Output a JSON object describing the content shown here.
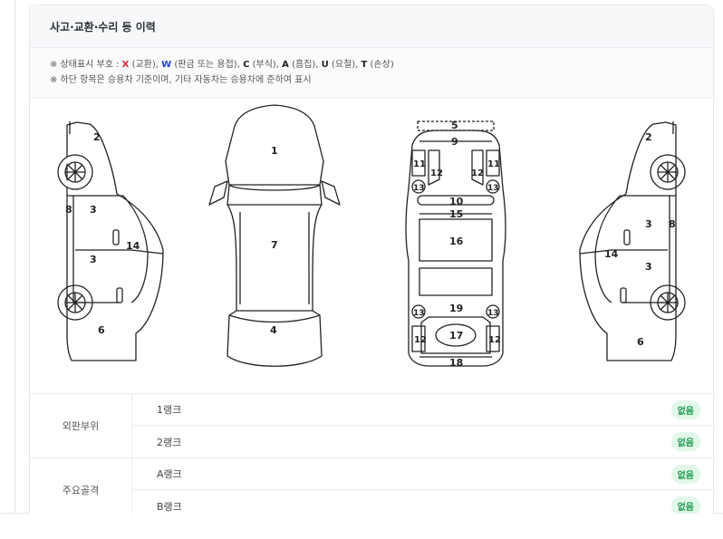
{
  "section": {
    "title": "사고·교환·수리 등 이력"
  },
  "legend": {
    "line1_prefix": "※ 상태표시 부호 : ",
    "x_code": "X",
    "x_text": " (교환), ",
    "w_code": "W",
    "w_text": " (판금 또는 용접), ",
    "c_code": "C",
    "c_text": " (부식), ",
    "a_code": "A",
    "a_text": " (흠집), ",
    "u_code": "U",
    "u_text": " (요철), ",
    "t_code": "T",
    "t_text": " (손상)",
    "line2": "※ 하단 항목은 승용차 기준이며, 기타 자동차는 승용차에 준하여 표시",
    "x_color": "#e0252d",
    "w_color": "#2244cc"
  },
  "diagram": {
    "left_side": [
      "2",
      "3",
      "8",
      "3",
      "14",
      "6"
    ],
    "top": [
      "1",
      "7",
      "4"
    ],
    "frame": [
      "5",
      "9",
      "11",
      "12",
      "13",
      "12",
      "11",
      "13",
      "10",
      "15",
      "16",
      "19",
      "13",
      "13",
      "17",
      "12",
      "12",
      "18"
    ],
    "right_side": [
      "2",
      "3",
      "8",
      "14",
      "3",
      "6"
    ]
  },
  "table": {
    "groups": [
      {
        "label": "외판부위",
        "rows": [
          {
            "label": "1랭크",
            "status": "없음"
          },
          {
            "label": "2랭크",
            "status": "없음"
          }
        ]
      },
      {
        "label": "주요골격",
        "rows": [
          {
            "label": "A랭크",
            "status": "없음"
          },
          {
            "label": "B랭크",
            "status": "없음"
          }
        ]
      }
    ],
    "badge_color": "#1e9e4f"
  }
}
